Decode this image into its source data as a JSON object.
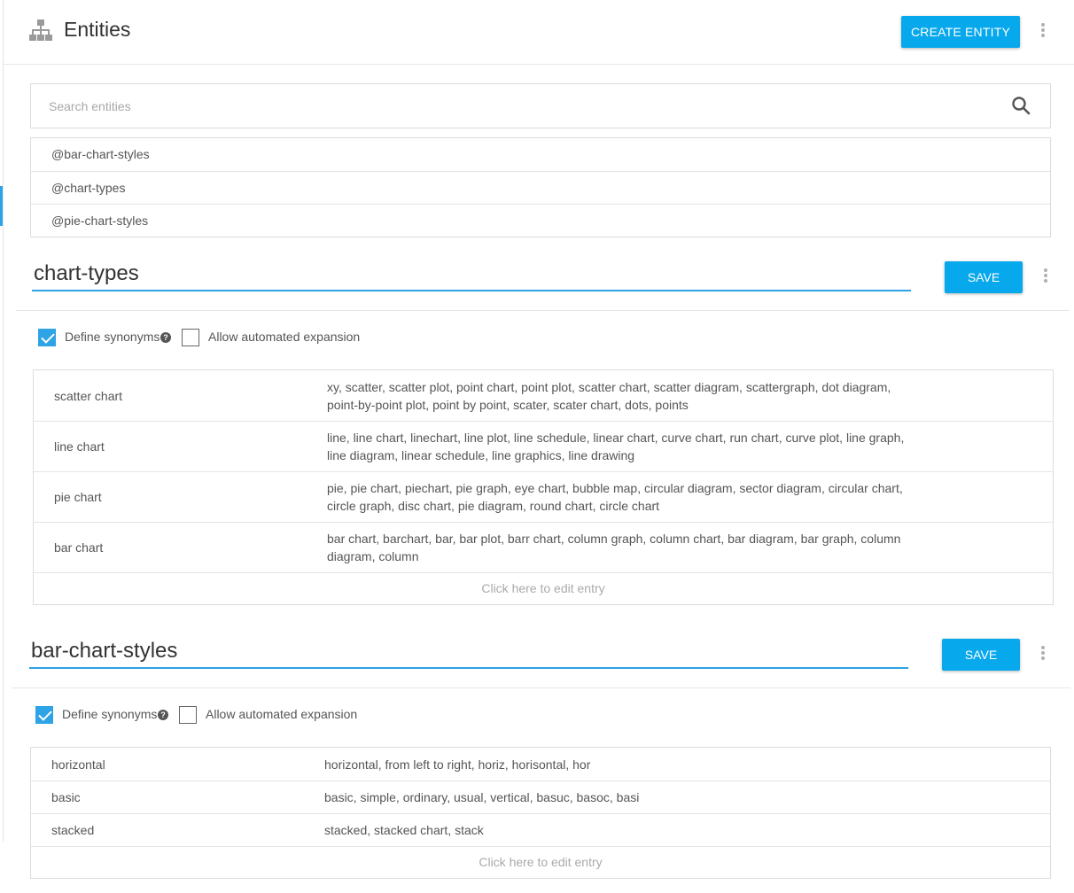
{
  "header": {
    "title": "Entities",
    "create_label": "CREATE ENTITY"
  },
  "search": {
    "placeholder": "Search entities"
  },
  "entity_list": [
    {
      "label": "@bar-chart-styles"
    },
    {
      "label": "@chart-types"
    },
    {
      "label": "@pie-chart-styles"
    }
  ],
  "sections": [
    {
      "name": "chart-types",
      "save_label": "SAVE",
      "define_synonyms": {
        "label": "Define synonyms",
        "checked": true
      },
      "auto_expansion": {
        "label": "Allow automated expansion",
        "checked": false
      },
      "entries": [
        {
          "value": "scatter chart",
          "synonyms": "xy, scatter, scatter plot, point chart, point plot, scatter chart, scatter diagram, scattergraph, dot diagram, point-by-point plot, point by point, scater, scater chart, dots, points"
        },
        {
          "value": "line chart",
          "synonyms": "line, line chart, linechart, line plot, line schedule, linear chart, curve chart, run chart, curve plot, line graph, line diagram, linear schedule, line graphics, line drawing"
        },
        {
          "value": "pie chart",
          "synonyms": "pie, pie chart, piechart, pie graph, eye chart, bubble map, circular diagram, sector diagram, circular chart, circle graph, disc chart, pie diagram, round chart, circle chart"
        },
        {
          "value": "bar chart",
          "synonyms": "bar chart, barchart, bar, bar plot, barr chart, column graph, column chart, bar diagram, bar graph, column diagram, column"
        }
      ],
      "edit_label": "Click here to edit entry"
    },
    {
      "name": "bar-chart-styles",
      "save_label": "SAVE",
      "define_synonyms": {
        "label": "Define synonyms",
        "checked": true
      },
      "auto_expansion": {
        "label": "Allow automated expansion",
        "checked": false
      },
      "entries": [
        {
          "value": "horizontal",
          "synonyms": "horizontal, from left to right, horiz, horisontal, hor"
        },
        {
          "value": "basic",
          "synonyms": "basic, simple, ordinary, usual, vertical, basuc, basoc, basi"
        },
        {
          "value": "stacked",
          "synonyms": "stacked, stacked chart, stack"
        }
      ],
      "edit_label": "Click here to edit entry"
    }
  ],
  "colors": {
    "accent": "#08a8ed",
    "underline": "#2ea3e6"
  },
  "icons": {
    "title": "sitemap-icon",
    "search": "search-icon",
    "more": "more-vert-icon",
    "help": "help-circle-icon"
  }
}
